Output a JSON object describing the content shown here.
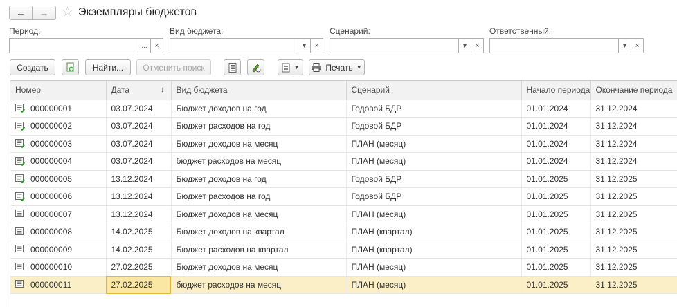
{
  "header": {
    "title": "Экземпляры бюджетов",
    "back": "←",
    "forward": "→",
    "star": "☆"
  },
  "filters": [
    {
      "label": "Период:",
      "btn1": "...",
      "btn2": "×"
    },
    {
      "label": "Вид бюджета:",
      "btn1": "▾",
      "btn2": "×"
    },
    {
      "label": "Сценарий:",
      "btn1": "▾",
      "btn2": "×"
    },
    {
      "label": "Ответственный:",
      "btn1": "▾",
      "btn2": "×"
    }
  ],
  "toolbar": {
    "create": "Создать",
    "find": "Найти...",
    "cancel_search": "Отменить поиск",
    "print": "Печать"
  },
  "table": {
    "columns": [
      "Номер",
      "Дата",
      "Вид бюджета",
      "Сценарий",
      "Начало периода",
      "Окончание периода"
    ],
    "sort_indicator": "↓",
    "rows": [
      {
        "num": "000000001",
        "date": "03.07.2024",
        "kind": "Бюджет доходов на год",
        "scenario": "Годовой БДР",
        "start": "01.01.2024",
        "end": "31.12.2024",
        "posted": true
      },
      {
        "num": "000000002",
        "date": "03.07.2024",
        "kind": "Бюджет расходов на год",
        "scenario": "Годовой БДР",
        "start": "01.01.2024",
        "end": "31.12.2024",
        "posted": true
      },
      {
        "num": "000000003",
        "date": "03.07.2024",
        "kind": "Бюджет доходов на месяц",
        "scenario": "ПЛАН (месяц)",
        "start": "01.01.2024",
        "end": "31.12.2024",
        "posted": true
      },
      {
        "num": "000000004",
        "date": "03.07.2024",
        "kind": "бюджет расходов на месяц",
        "scenario": "ПЛАН (месяц)",
        "start": "01.01.2024",
        "end": "31.12.2024",
        "posted": true
      },
      {
        "num": "000000005",
        "date": "13.12.2024",
        "kind": "Бюджет доходов на год",
        "scenario": "Годовой БДР",
        "start": "01.01.2025",
        "end": "31.12.2025",
        "posted": true
      },
      {
        "num": "000000006",
        "date": "13.12.2024",
        "kind": "Бюджет расходов на год",
        "scenario": "Годовой БДР",
        "start": "01.01.2025",
        "end": "31.12.2025",
        "posted": true
      },
      {
        "num": "000000007",
        "date": "13.12.2024",
        "kind": "Бюджет доходов на месяц",
        "scenario": "ПЛАН (месяц)",
        "start": "01.01.2025",
        "end": "31.12.2025",
        "posted": false
      },
      {
        "num": "000000008",
        "date": "14.02.2025",
        "kind": "Бюджет доходов на квартал",
        "scenario": "ПЛАН (квартал)",
        "start": "01.01.2025",
        "end": "31.12.2025",
        "posted": false
      },
      {
        "num": "000000009",
        "date": "14.02.2025",
        "kind": "Бюджет расходов на квартал",
        "scenario": "ПЛАН (квартал)",
        "start": "01.01.2025",
        "end": "31.12.2025",
        "posted": false
      },
      {
        "num": "000000010",
        "date": "27.02.2025",
        "kind": "Бюджет доходов на месяц",
        "scenario": "ПЛАН (месяц)",
        "start": "01.01.2025",
        "end": "31.12.2025",
        "posted": false
      },
      {
        "num": "000000011",
        "date": "27.02.2025",
        "kind": "бюджет расходов на месяц",
        "scenario": "ПЛАН (месяц)",
        "start": "01.01.2025",
        "end": "31.12.2025",
        "posted": false,
        "selected": true
      }
    ]
  },
  "colors": {
    "selected_row": "#faefc7",
    "current_cell_border": "#e0b83d",
    "posted_mark": "#3a9a3a"
  }
}
